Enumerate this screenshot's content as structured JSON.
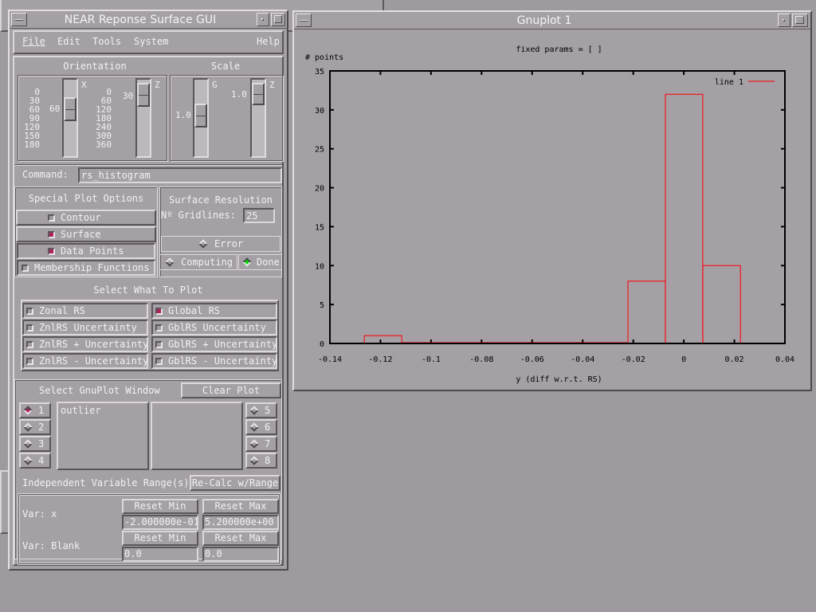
{
  "rs_gui": {
    "title": "NEAR Reponse Surface GUI",
    "menu": {
      "file": "File",
      "edit": "Edit",
      "tools": "Tools",
      "system": "System",
      "help": "Help"
    },
    "orientation": {
      "label": "Orientation",
      "x_slider": {
        "axis_label": "X",
        "value": "60",
        "ticks": [
          "0",
          "30",
          "60",
          "90",
          "120",
          "150",
          "180"
        ]
      },
      "z_slider": {
        "axis_label": "Z",
        "value": "30",
        "ticks": [
          "0",
          "60",
          "120",
          "180",
          "240",
          "300",
          "360"
        ]
      }
    },
    "scale": {
      "label": "Scale",
      "g_slider": {
        "axis_label": "G",
        "value": "1.0"
      },
      "z_slider": {
        "axis_label": "Z",
        "value": "1.0"
      }
    },
    "command": {
      "label": "Command:",
      "value": "rs_histogram"
    },
    "special_plot_options": {
      "label": "Special Plot Options",
      "options": [
        {
          "label": "Contour",
          "checked": false
        },
        {
          "label": "Surface",
          "checked": true
        },
        {
          "label": "Data Points",
          "checked": true
        },
        {
          "label": "Membership Functions",
          "checked": false
        }
      ]
    },
    "surface_resolution": {
      "label": "Surface Resolution",
      "gridlines_label": "Nº Gridlines:",
      "gridlines_value": "25",
      "status": {
        "error": "Error",
        "computing": "Computing",
        "done": "Done",
        "active": "done"
      }
    },
    "select_what_to_plot": {
      "label": "Select What To Plot",
      "left": [
        {
          "label": "Zonal RS",
          "checked": false
        },
        {
          "label": "ZnlRS Uncertainty",
          "checked": false
        },
        {
          "label": "ZnlRS + Uncertainty",
          "checked": false
        },
        {
          "label": "ZnlRS - Uncertainty",
          "checked": false
        }
      ],
      "right": [
        {
          "label": "Global RS",
          "checked": true
        },
        {
          "label": "GblRS Uncertainty",
          "checked": false
        },
        {
          "label": "GblRS + Uncertainty",
          "checked": false
        },
        {
          "label": "GblRS - Uncertainty",
          "checked": false
        }
      ]
    },
    "gnuplot_window": {
      "label": "Select GnuPlot Window",
      "clear_button": "Clear Plot",
      "windows_left": [
        "1",
        "2",
        "3",
        "4"
      ],
      "windows_right": [
        "5",
        "6",
        "7",
        "8"
      ],
      "selected": "1",
      "list_left": [
        "outlier"
      ],
      "list_right": []
    },
    "range": {
      "label": "Independent Variable Range(s)",
      "recalc_button": "Re-Calc w/Range",
      "vars": [
        {
          "label": "Var: x",
          "reset_min": "Reset Min",
          "reset_max": "Reset Max",
          "min": "-2.000000e-01",
          "max": "5.200000e+00"
        },
        {
          "label": "Var: Blank",
          "reset_min": "Reset Min",
          "reset_max": "Reset Max",
          "min": "0.0",
          "max": "0.0"
        }
      ]
    }
  },
  "gnuplot": {
    "title": "Gnuplot 1"
  },
  "chart_data": {
    "type": "bar",
    "subtype": "histogram-steps",
    "title": "fixed params = [ ]",
    "xlabel": "y (diff w.r.t. RS)",
    "ylabel": "# points",
    "xlim": [
      -0.14,
      0.04
    ],
    "ylim": [
      0,
      35
    ],
    "xticks": [
      "-0.14",
      "-0.12",
      "-0.1",
      "-0.08",
      "-0.06",
      "-0.04",
      "-0.02",
      "0",
      "0.02",
      "0.04"
    ],
    "xtick_values": [
      -0.14,
      -0.12,
      -0.1,
      -0.08,
      -0.06,
      -0.04,
      -0.02,
      0,
      0.02,
      0.04
    ],
    "yticks": [
      "0",
      "5",
      "10",
      "15",
      "20",
      "25",
      "30",
      "35"
    ],
    "ytick_values": [
      0,
      5,
      10,
      15,
      20,
      25,
      30,
      35
    ],
    "grid": false,
    "legend": {
      "position": "top-right",
      "entries": [
        {
          "name": "line 1",
          "color": "#ff0000"
        }
      ]
    },
    "bins": [
      {
        "x0": -0.1264,
        "x1": -0.1116,
        "count": 1
      },
      {
        "x0": -0.1116,
        "x1": -0.0221,
        "count": 0
      },
      {
        "x0": -0.0221,
        "x1": -0.0073,
        "count": 8
      },
      {
        "x0": -0.0073,
        "x1": 0.0075,
        "count": 32
      },
      {
        "x0": 0.0075,
        "x1": 0.0224,
        "count": 10
      }
    ],
    "series_color": "#ff0000"
  }
}
